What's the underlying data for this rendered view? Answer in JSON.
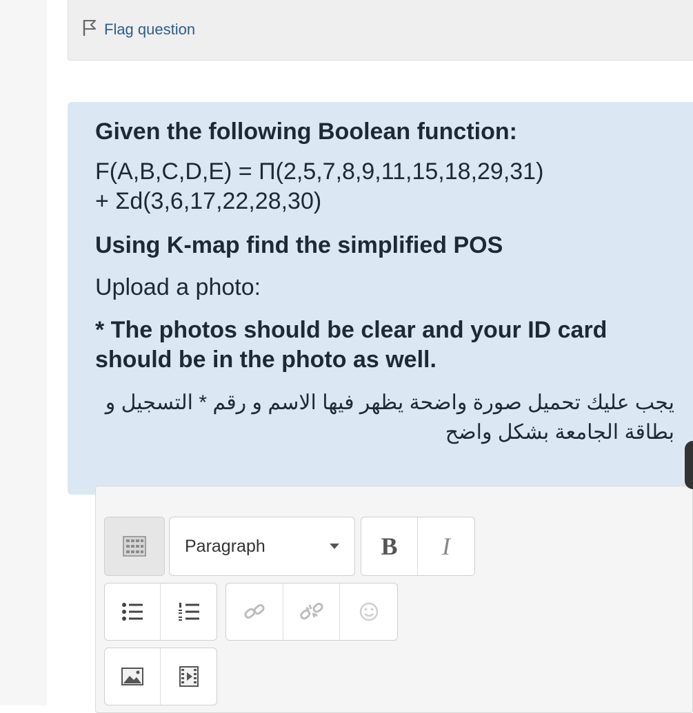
{
  "flag": {
    "label": "Flag question",
    "icon": "flag-icon"
  },
  "question": {
    "title": "Given the following Boolean function:",
    "formula_line1": "F(A,B,C,D,E) = Π(2,5,7,8,9,11,15,18,29,31)",
    "formula_line2": "+ Σd(3,6,17,22,28,30)",
    "instruction": "Using K-map find the simplified POS",
    "upload": "Upload a photo:",
    "note_en": "* The photos should be clear and your ID card should be in the photo as well.",
    "note_ar": "يجب عليك تحميل صورة واضحة يظهر فيها الاسم و رقم * التسجيل و بطاقة الجامعة بشكل واضح"
  },
  "editor": {
    "paragraph_label": "Paragraph",
    "bold_label": "B",
    "italic_label": "I",
    "icons": [
      "toolbar-toggle-icon",
      "unordered-list-icon",
      "ordered-list-icon",
      "link-icon",
      "unlink-icon",
      "emoji-icon",
      "image-icon",
      "media-icon"
    ]
  },
  "colors": {
    "question_background": "#dbe8f3",
    "info_background": "#efefef",
    "link": "#2d5d8a",
    "text": "#1c2a36"
  }
}
